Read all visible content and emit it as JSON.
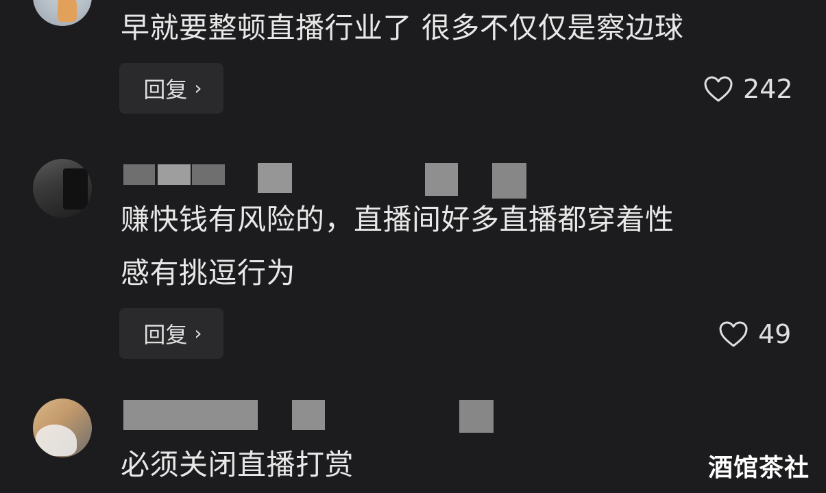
{
  "comments": [
    {
      "text_lines": [
        "早就要整顿直播行业了 很多不仅仅是察边球"
      ],
      "reply_label": "回复",
      "likes": "242"
    },
    {
      "text_lines": [
        "赚快钱有风险的，直播间好多直播都穿着性",
        "感有挑逗行为"
      ],
      "reply_label": "回复",
      "likes": "49"
    },
    {
      "text_lines": [
        "必须关闭直播打赏"
      ]
    }
  ],
  "icons": {
    "like": "heart-outline-icon",
    "reply_chevron": "chevron-right-icon"
  },
  "watermark": "酒馆茶社"
}
